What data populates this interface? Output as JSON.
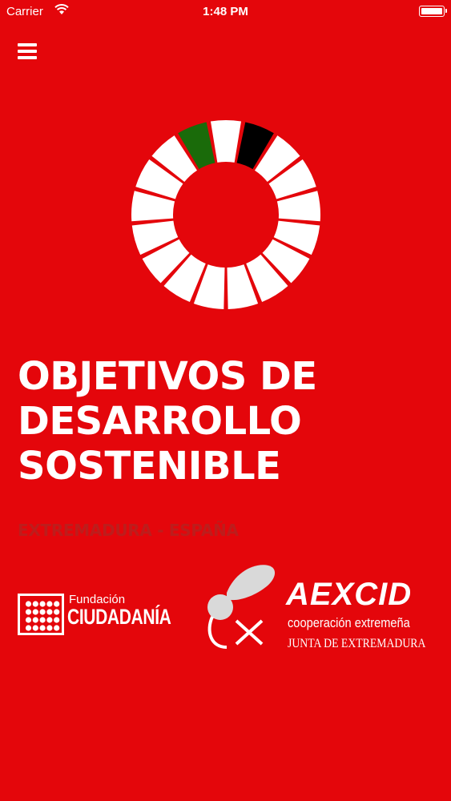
{
  "status_bar": {
    "carrier": "Carrier",
    "time": "1:48 PM"
  },
  "icons": {
    "menu": "menu-icon",
    "wifi": "wifi-icon",
    "battery": "battery-icon"
  },
  "hero": {
    "title_lines": [
      "OBJETIVOS DE",
      "DESARROLLO",
      "SOSTENIBLE"
    ],
    "subtitle": "EXTREMADURA - ESPAÑA"
  },
  "logos": {
    "fundacion_small": "Fundación",
    "fundacion_big": "CIUDADANÍA",
    "aexcid_name": "AEXCID",
    "aexcid_sub1": "cooperación extremeña",
    "aexcid_sub2": "JUNTA DE EXTREMADURA"
  },
  "colors": {
    "background": "#e4060b",
    "foreground": "#ffffff",
    "subtitle": "#bd1d1c",
    "wheel_highlight_green": "#1a6b0a",
    "wheel_highlight_black": "#000000"
  }
}
